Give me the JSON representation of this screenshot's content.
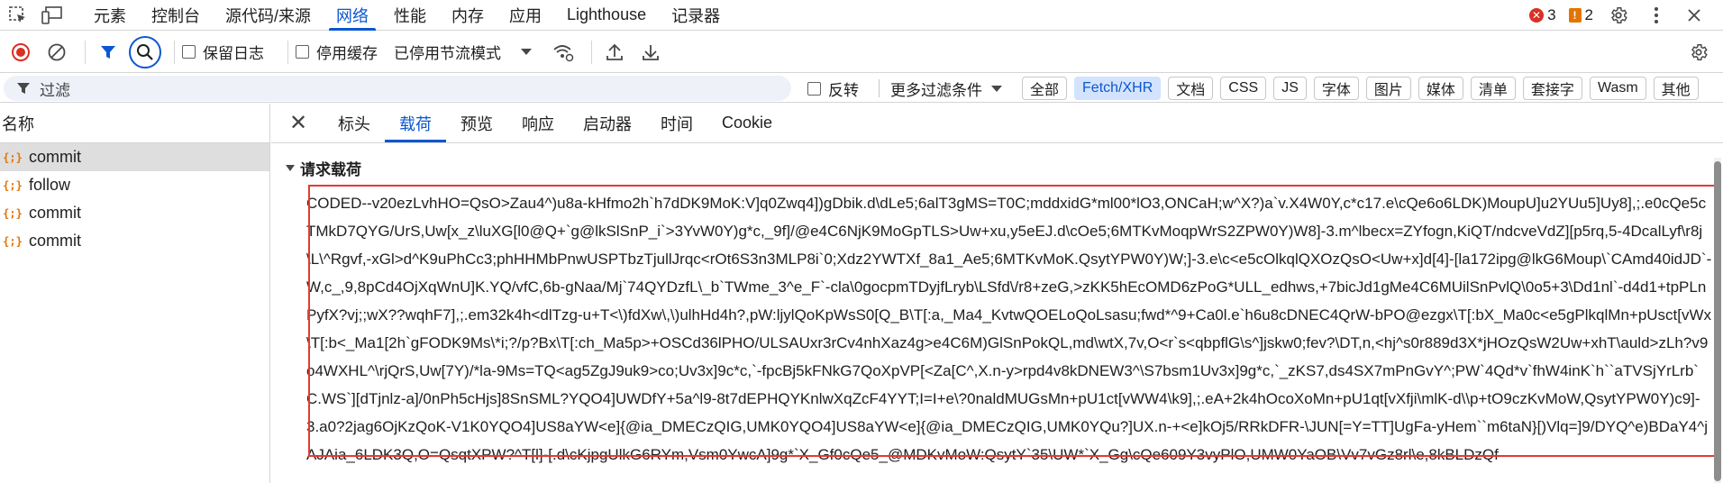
{
  "topbar": {
    "tabs": [
      "元素",
      "控制台",
      "源代码/来源",
      "网络",
      "性能",
      "内存",
      "应用",
      "Lighthouse",
      "记录器"
    ],
    "active_tab": "网络",
    "error_count": "3",
    "warning_count": "2"
  },
  "toolbar": {
    "preserve_log": "保留日志",
    "disable_cache": "停用缓存",
    "throttle": "已停用节流模式"
  },
  "filter": {
    "placeholder": "过滤",
    "invert": "反转",
    "more_filters": "更多过滤条件",
    "types": [
      "全部",
      "Fetch/XHR",
      "文档",
      "CSS",
      "JS",
      "字体",
      "图片",
      "媒体",
      "清单",
      "套接字",
      "Wasm",
      "其他"
    ],
    "active_type": "Fetch/XHR"
  },
  "requests": {
    "header": "名称",
    "items": [
      {
        "name": "commit",
        "selected": true
      },
      {
        "name": "follow",
        "selected": false
      },
      {
        "name": "commit",
        "selected": false
      },
      {
        "name": "commit",
        "selected": false
      }
    ]
  },
  "details": {
    "tabs": [
      "标头",
      "载荷",
      "预览",
      "响应",
      "启动器",
      "时间",
      "Cookie"
    ],
    "active_tab": "载荷",
    "section_title": "请求载荷",
    "payload": "CODED--v20ezLvhHO=QsO>Zau4^)u8a-kHfmo2h`h7dDK9MoK:V]q0Zwq4])gDbik.d\\dLe5;6alT3gMS=T0C;mddxidG*ml00*lO3,ONCaH;w^X?)a`v.X4W0Y,c*c17.e\\cQe6o6LDK)MoupU]u2YUu5]Uy8],;.e0cQe5cTMkD7QYG/UrS,Uw[x_z\\luXG[l0@Q+`g@lkSlSnP_i`>3YvW0Y)g*c,_9f]/@e4C6NjK9MoGpTLS>Uw+xu,y5eEJ.d\\cOe5;6MTKvMoqpWrS2ZPW0Y)W8]-3.m^lbecx=ZYfogn,KiQT/ndcveVdZ][p5rq,5-4DcalLyf\\r8j\\L\\^Rgvf,-xGl>d^K9uPhCc3;phHHMbPnwUSPTbzTjullJrqc<rOt6S3n3MLP8i`0;Xdz2YWTXf_8a1_Ae5;6MTKvMoK.QsytYPW0Y)W;]-3.e\\c<e5cOlkqlQXOzQsO<Uw+x]d[4]-[la172ipg@lkG6Moup\\`CAmd40idJD`-W,c_,9,8pCd4OjXqWnU]K.YQ/vfC,6b-gNaa/Mj`74QYDzfL\\_b`TWme_3^e_F`-cla\\0gocpmTDyjfLryb\\LSfd\\/r8+zeG,>zKK5hEcOMD6zPoG*ULL_edhws,+7bicJd1gMe4C6MUilSnPvlQ\\0o5+3\\Dd1nl`-d4d1+tpPLnPyfX?vj;;wX??wqhF7],;.em32k4h<dlTzg-u+T<\\)fdXw\\,\\)ulhHd4h?,pW:ljylQoKpWsS0[Q_B\\T[:a,_Ma4_KvtwQOELoQoLsasu;fwd*^9+Ca0l.e`h6u8cDNEC4QrW-bPO@ezgx\\T[:bX_Ma0c<e5gPlkqlMn+pUsct[vWx\\T[:b<_Ma1[2h`gFODK9Ms\\*i;?/p?Bx\\T[:ch_Ma5p>+OSCd36lPHO/ULSAUxr3rCv4nhXaz4g>e4C6M)GlSnPokQL,md\\wtX,7v,O<r`s<qbpflG\\s^]jskw0;fev?\\DT,n,<hj^s0r889d3X*jHOzQsW2Uw+xhT\\auld>zLh?v9o4WXHL^\\rjQrS,Uw[7Y)/*la-9Ms=TQ<ag5ZgJ9uk9>co;Uv3x]9c*c,`-fpcBj5kFNkG7QoXpVP[<Za[C^,X.n-y>rpd4v8kDNEW3^\\S7bsm1Uv3x]9g*c,`_zKS7,ds4SX7mPnGvY^;PW`4Qd*v`fhW4inK`h``aTVSjYrLrb`C.WS`][dTjnlz-a]/0nPh5cHjs]8SnSML?YQO4]UWDfY+5a^l9-8t7dEPHQYKnlwXqZcF4YYT;I=I+e\\?0naldMUGsMn+pU1ct[vWW4\\k9],;.eA+2k4hOcoXoMn+pU1qt[vXfji\\mlK-d\\\\p+tO9czKvMoW,QsytYPW0Y)c9]-3.a0?2jag6OjKzQoK-V1K0YQO4]US8aYW<e]{@ia_DMECzQIG,UMK0YQO4]US8aYW<e]{@ia_DMECzQIG,UMK0YQu?]UX.n-+<e]kOj5/RRkDFR-\\JUN[=Y=TT]UgFa-yHem``m6taN}[)Vlq=]9/DYQ^e)BDaY4^jAJAia_6LDK3Q,O=QsqtXPW?^T[l]-[.d\\cKjpgUlkG6RYm,Vsm0YwcA]9g*`X_Gf0cQe5_@MDKvMoW:QsytY`35\\UW*`X_Gg\\cQe609Y3vyPlO,UMW0YaOB\\Vv7vGz8rl\\e,8kBLDzQf"
  }
}
